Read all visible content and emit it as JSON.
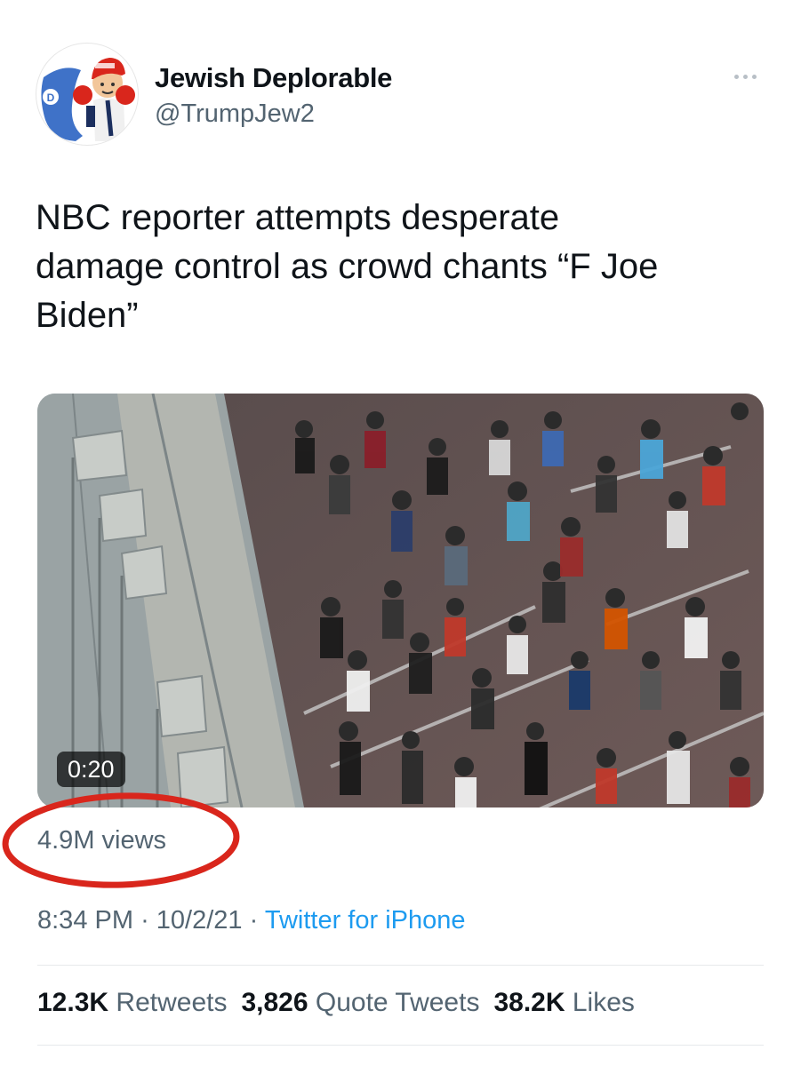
{
  "author": {
    "display_name": "Jewish Deplorable",
    "handle": "@TrumpJew2",
    "avatar": "cartoon-boxer-avatar"
  },
  "tweet": {
    "text": "NBC reporter attempts desperate\ndamage control as crowd chants “F Joe\nBiden”"
  },
  "media": {
    "type": "video",
    "duration": "0:20",
    "views": "4.9M views"
  },
  "meta": {
    "time": "8:34 PM",
    "separator": "·",
    "date": "10/2/21",
    "source": "Twitter for iPhone"
  },
  "stats": {
    "retweets_count": "12.3K",
    "retweets_label": "Retweets",
    "quotes_count": "3,826",
    "quotes_label": "Quote Tweets",
    "likes_count": "38.2K",
    "likes_label": "Likes"
  },
  "colors": {
    "annotation_circle": "#d9261c",
    "link": "#1d9bf0",
    "secondary_text": "#536471"
  }
}
